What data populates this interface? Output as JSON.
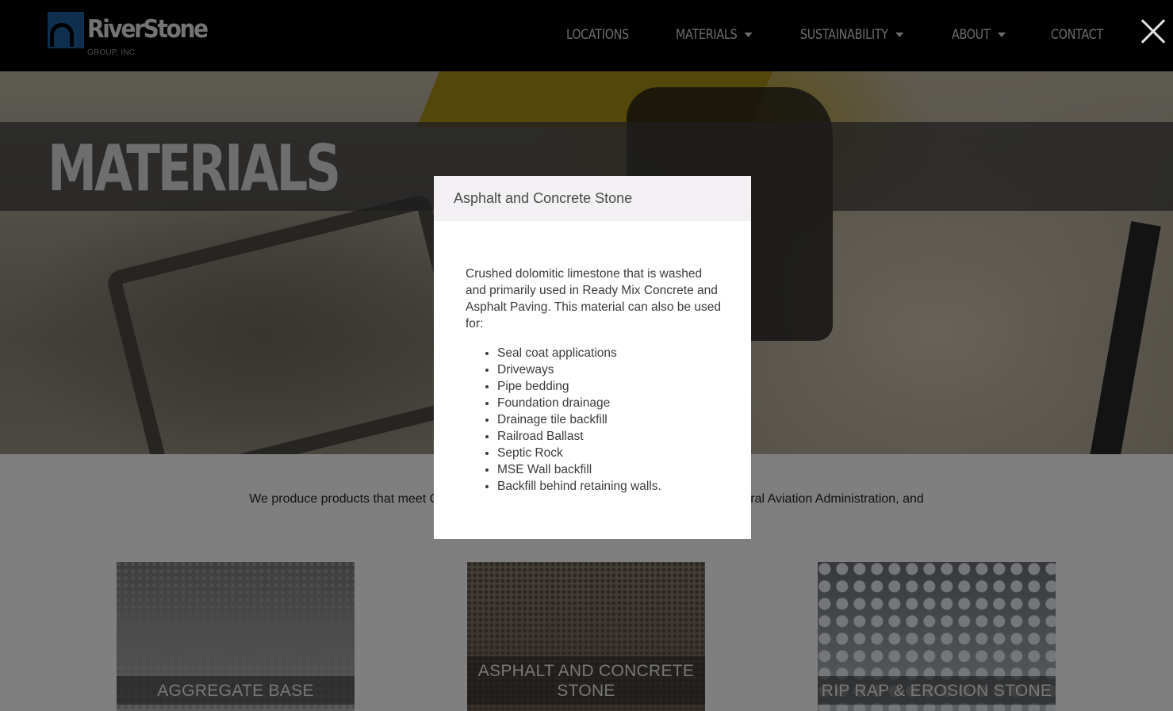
{
  "brand": {
    "name": "RiverStone",
    "sub": "GROUP, INC."
  },
  "nav": {
    "items": [
      {
        "label": "LOCATIONS",
        "dropdown": false
      },
      {
        "label": "MATERIALS",
        "dropdown": true
      },
      {
        "label": "SUSTAINABILITY",
        "dropdown": true
      },
      {
        "label": "ABOUT",
        "dropdown": true
      },
      {
        "label": "CONTACT",
        "dropdown": false
      }
    ]
  },
  "hero": {
    "title": "MATERIALS"
  },
  "intro": {
    "text": "We produce products that meet Quality Control and Quality ... nts of Transportation, Federal Aviation Administration, and"
  },
  "cards": [
    {
      "label": "AGGREGATE BASE"
    },
    {
      "label": "ASPHALT AND CONCRETE STONE"
    },
    {
      "label": "RIP RAP & EROSION STONE"
    }
  ],
  "modal": {
    "title": "Asphalt and Concrete Stone",
    "description": "Crushed dolomitic limestone that is washed and primarily used in Ready Mix Concrete and Asphalt Paving. This material can also be used for:",
    "uses": [
      "Seal coat applications",
      "Driveways",
      "Pipe bedding",
      "Foundation drainage",
      "Drainage tile backfill",
      "Railroad Ballast",
      "Septic Rock",
      "MSE Wall backfill",
      "Backfill behind retaining walls."
    ]
  },
  "colors": {
    "header_bg": "#000000",
    "logo_blue": "#1f5f9c",
    "modal_header_bg": "#f2f0f3"
  }
}
